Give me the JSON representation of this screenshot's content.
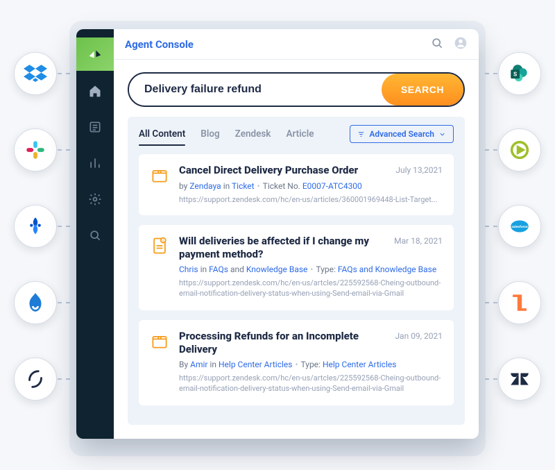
{
  "header": {
    "title": "Agent Console"
  },
  "search": {
    "value": "Delivery failure refund",
    "button": "SEARCH"
  },
  "tabs": {
    "all": "All Content",
    "blog": "Blog",
    "zendesk": "Zendesk",
    "article": "Article",
    "advanced": "Advanced Search"
  },
  "results": [
    {
      "title": "Cancel Direct Delivery Purchase Order",
      "date": "July 13,2021",
      "meta_pre": "by ",
      "author": "Zendaya",
      "meta_mid": " in ",
      "category": "Ticket",
      "meta_post": "Ticket No.",
      "ticket": "E0007-ATC4300",
      "url": "https://support.zendesk.com/hc/en-us/articles/360001969448-List-Target..."
    },
    {
      "title": "Will deliveries be affected if I change my payment method?",
      "date": "Mar 18, 2021",
      "author": "Chris",
      "meta_mid": " in ",
      "cat1": "FAQs",
      "and": " and ",
      "cat2": "Knowledge Base",
      "type_label": "Type:",
      "type_value": "FAQs and Knowledge Base",
      "url": "https://support.zendesk.com/hc/en-us/artcles/225592568-Cheing-outbound-email-notification-delivery-status-when-using-Send-email-via-Gmail"
    },
    {
      "title": "Processing Refunds for an Incomplete Delivery",
      "date": "Jan 09, 2021",
      "meta_pre": "By ",
      "author": "Amir",
      "meta_mid": " in ",
      "category": "Help Center Articles",
      "type_label": "Type:",
      "type_value": "Help Center Articles",
      "url": "https://support.zendesk.com/hc/en-us/artcles/225592568-Cheing-outbound-email-notification-delivery-status-when-using-Send-email-via-Gmail"
    }
  ],
  "integrations": {
    "left": [
      "dropbox",
      "slack",
      "jira",
      "drupal",
      "contentful"
    ],
    "right": [
      "sharepoint",
      "madcap",
      "salesforce",
      "helpshift",
      "zendesk"
    ]
  }
}
